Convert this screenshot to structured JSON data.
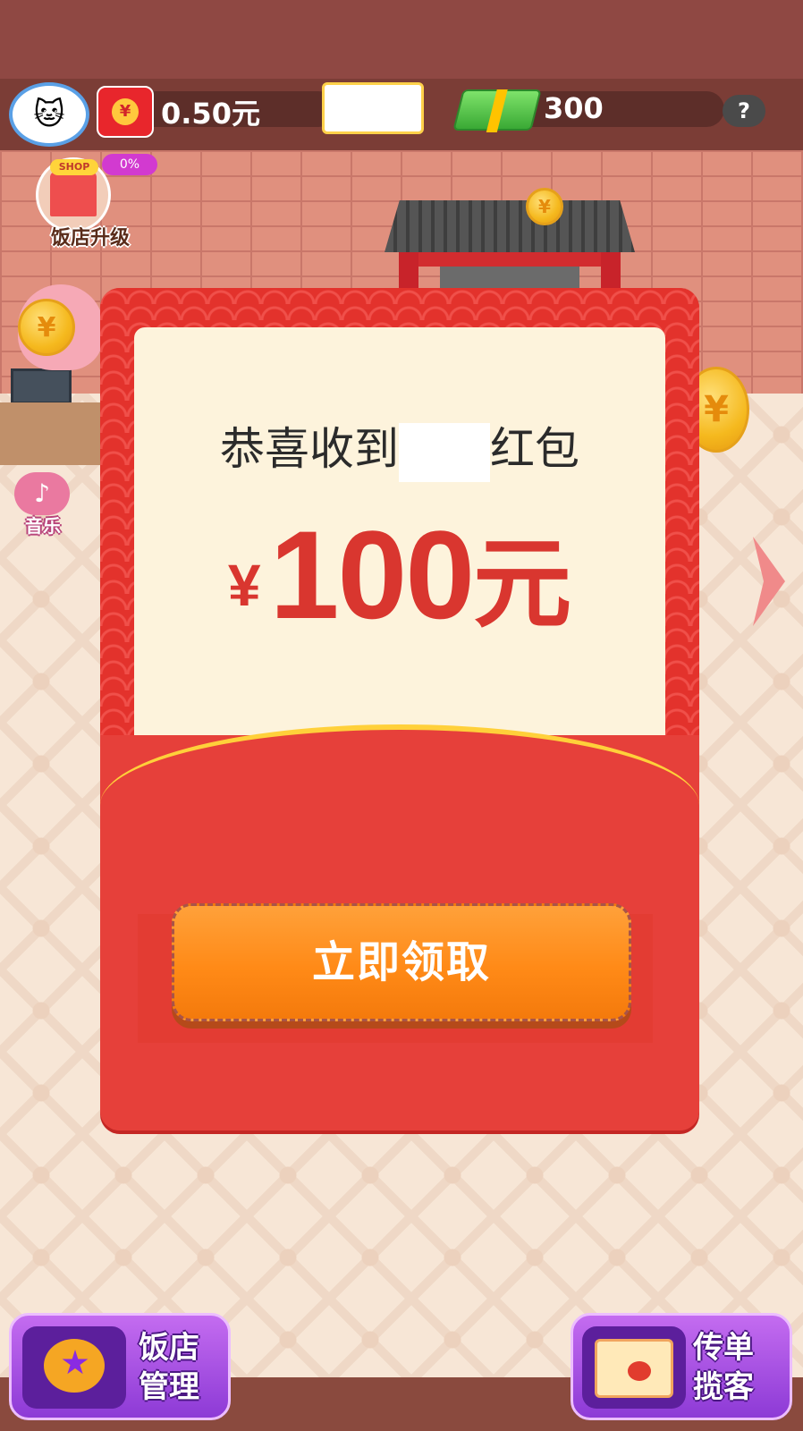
{
  "hud": {
    "cash": "0.50元",
    "money": "300",
    "help": "?",
    "red_packet_symbol": "¥"
  },
  "side": {
    "shop_sign": "SHOP",
    "shop_progress": "0%",
    "shop_label": "饭店升级",
    "music_label": "音乐",
    "coin_symbol": "¥"
  },
  "modal": {
    "congrats_prefix": "恭喜收到",
    "congrats_suffix": "红包",
    "currency_symbol": "¥",
    "amount": "100",
    "unit": "元",
    "claim_button": "立即领取"
  },
  "bottom": {
    "manage_label_line1": "饭店",
    "manage_label_line2": "管理",
    "flyer_label_line1": "传单",
    "flyer_label_line2": "揽客"
  },
  "colors": {
    "envelope_red": "#e33c33",
    "letter_cream": "#fdf3dc",
    "amount_red": "#d9362f",
    "button_orange": "#ff8a17",
    "hud_brown": "#7b3d36",
    "bottom_button_purple": "#8d3ad6"
  }
}
